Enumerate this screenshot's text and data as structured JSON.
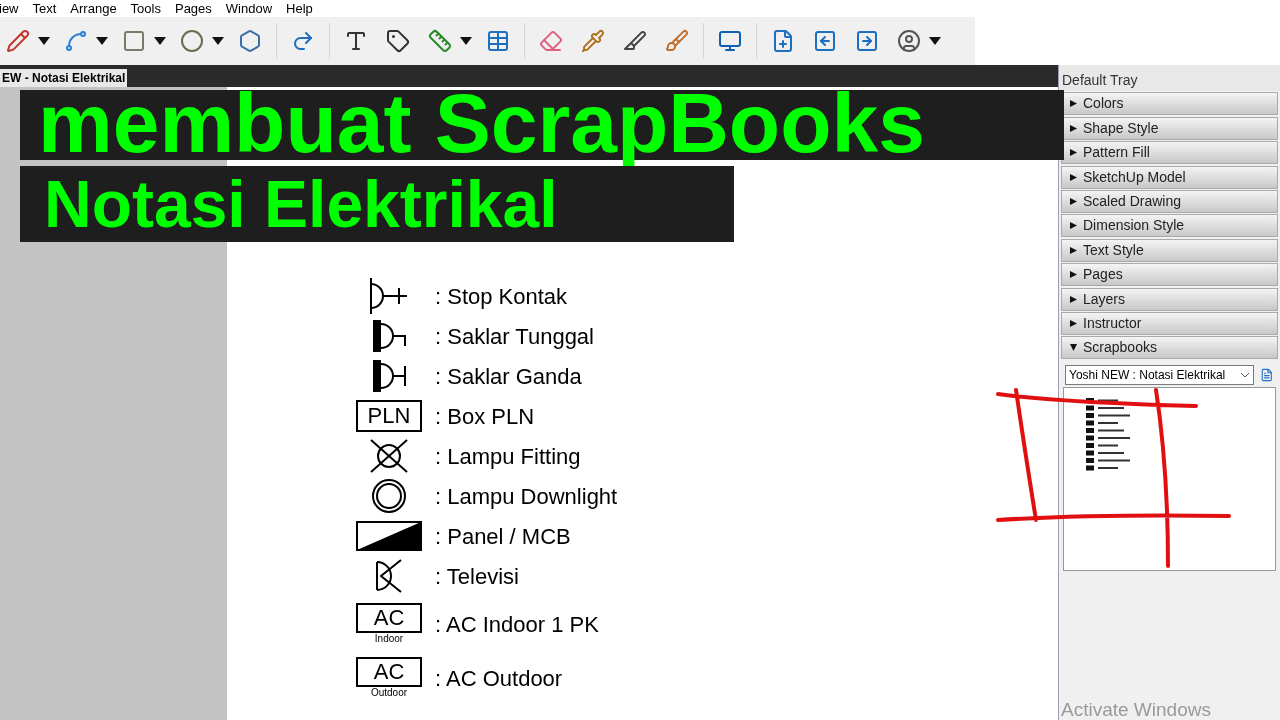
{
  "menu": [
    {
      "label": "iew"
    },
    {
      "label": "Text"
    },
    {
      "label": "Arrange"
    },
    {
      "label": "Tools"
    },
    {
      "label": "Pages"
    },
    {
      "label": "Window"
    },
    {
      "label": "Help"
    }
  ],
  "document_tab": {
    "label": "EW - Notasi Elektrikal"
  },
  "overlay_title": [
    "membuat ScrapBooks",
    "Notasi Elektrikal"
  ],
  "legend": [
    {
      "kind": "outlet",
      "label": ": Stop Kontak"
    },
    {
      "kind": "switch_single",
      "label": ": Saklar Tunggal"
    },
    {
      "kind": "switch_double",
      "label": ": Saklar Ganda"
    },
    {
      "kind": "box",
      "symbol_text": "PLN",
      "label": ": Box PLN"
    },
    {
      "kind": "lamp_fitting",
      "label": ": Lampu Fitting"
    },
    {
      "kind": "downlight",
      "label": ": Lampu Downlight"
    },
    {
      "kind": "panel",
      "label": ": Panel / MCB"
    },
    {
      "kind": "tv",
      "label": ": Televisi"
    },
    {
      "kind": "ac",
      "symbol_text": "AC",
      "symbol_subtext": "Indoor",
      "label": ": AC Indoor 1 PK"
    },
    {
      "kind": "ac",
      "symbol_text": "AC",
      "symbol_subtext": "Outdoor",
      "label": ": AC Outdoor"
    }
  ],
  "tray": {
    "title": "Default Tray",
    "panels": [
      {
        "label": "Colors",
        "expanded": false
      },
      {
        "label": "Shape Style",
        "expanded": false
      },
      {
        "label": "Pattern Fill",
        "expanded": false
      },
      {
        "label": "SketchUp Model",
        "expanded": false
      },
      {
        "label": "Scaled Drawing",
        "expanded": false
      },
      {
        "label": "Dimension Style",
        "expanded": false
      },
      {
        "label": "Text Style",
        "expanded": false
      },
      {
        "label": "Pages",
        "expanded": false
      },
      {
        "label": "Layers",
        "expanded": false
      },
      {
        "label": "Instructor",
        "expanded": false
      },
      {
        "label": "Scrapbooks",
        "expanded": true
      }
    ],
    "scrapbook_select": {
      "value": "Yoshi NEW : Notasi Elektrikal"
    }
  },
  "os_watermark": "Activate Windows"
}
